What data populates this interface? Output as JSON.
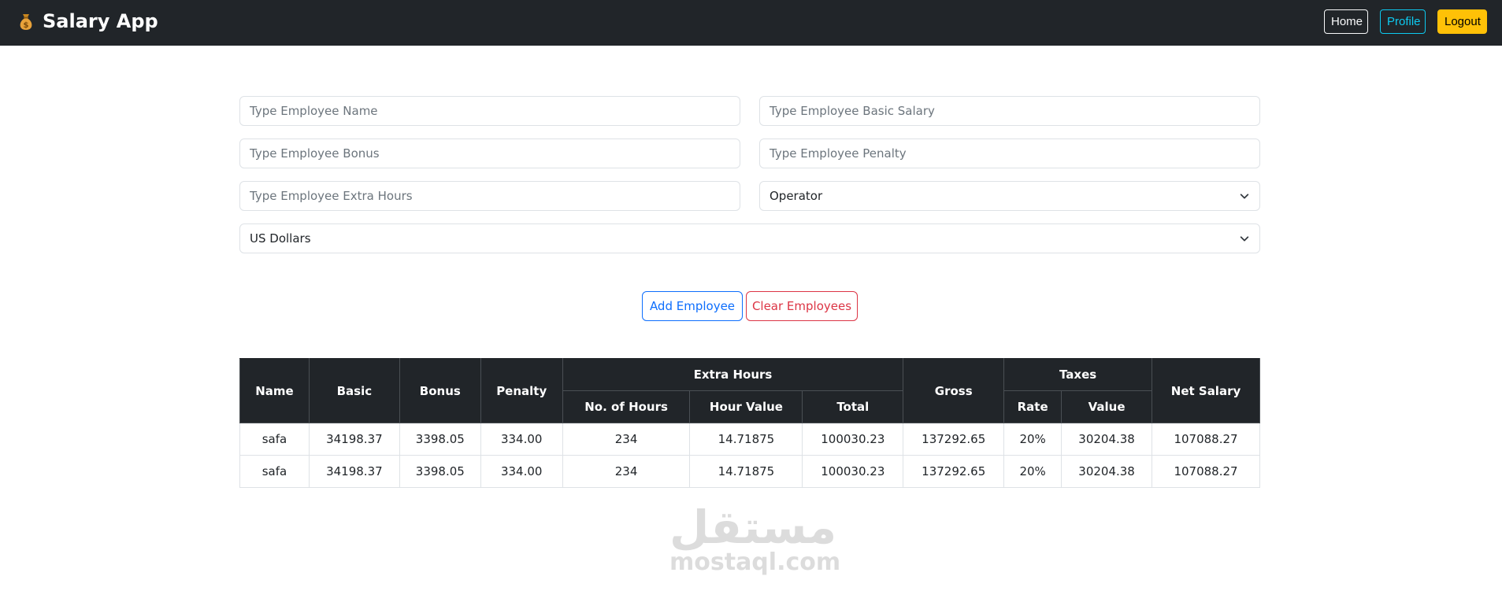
{
  "app": {
    "title": "Salary App",
    "brand_icon": "money-bag-icon"
  },
  "nav": {
    "home": "Home",
    "profile": "Profile",
    "logout": "Logout"
  },
  "form": {
    "name_placeholder": "Type Employee Name",
    "basic_placeholder": "Type Employee Basic Salary",
    "bonus_placeholder": "Type Employee Bonus",
    "penalty_placeholder": "Type Employee Penalty",
    "extra_hours_placeholder": "Type Employee Extra Hours",
    "role_selected": "Operator",
    "currency_selected": "US Dollars",
    "add_label": "Add Employee",
    "clear_label": "Clear Employees"
  },
  "table": {
    "headers": {
      "name": "Name",
      "basic": "Basic",
      "bonus": "Bonus",
      "penalty": "Penalty",
      "extra_hours": "Extra Hours",
      "no_of_hours": "No. of Hours",
      "hour_value": "Hour Value",
      "total": "Total",
      "gross": "Gross",
      "taxes": "Taxes",
      "rate": "Rate",
      "value": "Value",
      "net_salary": "Net Salary"
    },
    "rows": [
      {
        "name": "safa",
        "basic": "34198.37",
        "bonus": "3398.05",
        "penalty": "334.00",
        "hours": "234",
        "hour_value": "14.71875",
        "total": "100030.23",
        "gross": "137292.65",
        "rate": "20%",
        "tax_value": "30204.38",
        "net": "107088.27"
      },
      {
        "name": "safa",
        "basic": "34198.37",
        "bonus": "3398.05",
        "penalty": "334.00",
        "hours": "234",
        "hour_value": "14.71875",
        "total": "100030.23",
        "gross": "137292.65",
        "rate": "20%",
        "tax_value": "30204.38",
        "net": "107088.27"
      }
    ]
  },
  "watermark": {
    "arabic": "مستقل",
    "latin": "mostaql.com"
  },
  "colors": {
    "navbar": "#212529",
    "primary": "#0d6efd",
    "danger": "#dc3545",
    "info": "#0dcaf0",
    "warning": "#ffc107"
  }
}
